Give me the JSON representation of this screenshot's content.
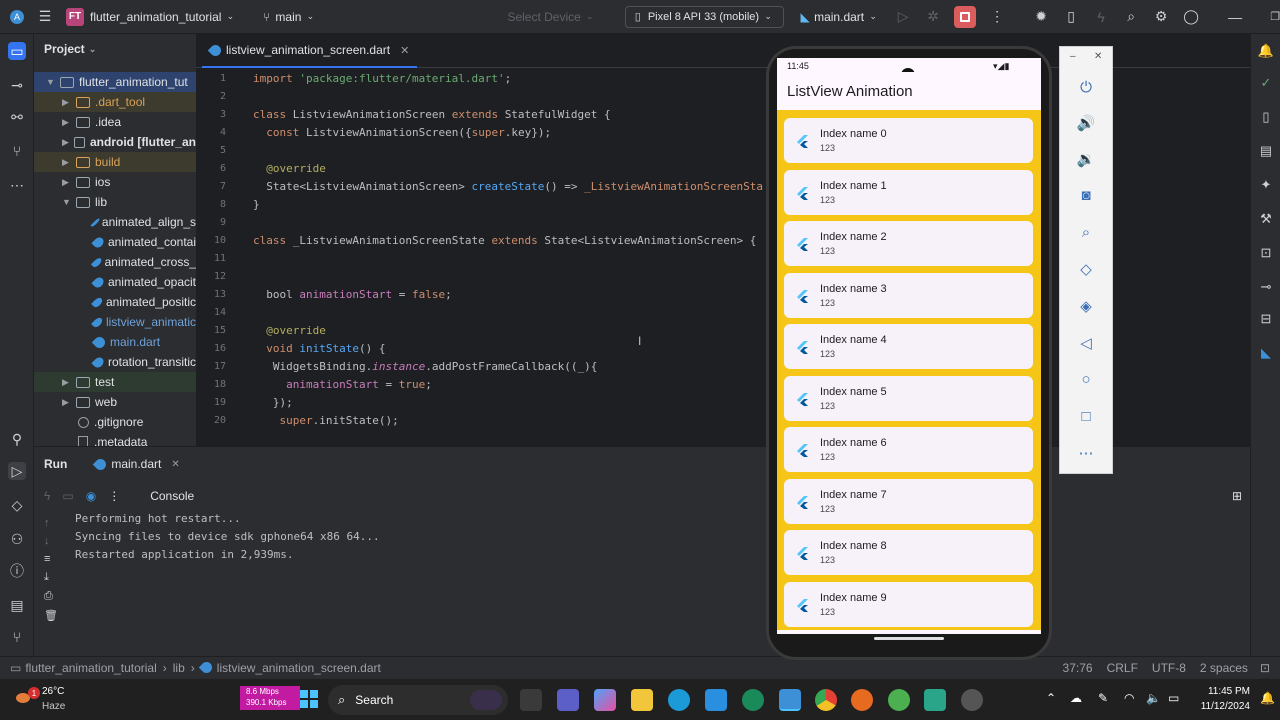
{
  "titlebar": {
    "project_badge": "FT",
    "project_name": "flutter_animation_tutorial",
    "branch": "main",
    "select_device": "Select Device",
    "device": "Pixel 8 API 33 (mobile)",
    "run_config": "main.dart"
  },
  "project_panel": {
    "title": "Project",
    "items": [
      {
        "label": "flutter_animation_tut",
        "type": "root"
      },
      {
        "label": ".dart_tool",
        "type": "folder-orange"
      },
      {
        "label": ".idea",
        "type": "folder"
      },
      {
        "label": "android [flutter_an",
        "type": "folder"
      },
      {
        "label": "build",
        "type": "folder-orange"
      },
      {
        "label": "ios",
        "type": "folder"
      },
      {
        "label": "lib",
        "type": "folder"
      },
      {
        "label": "animated_align_s",
        "type": "dart"
      },
      {
        "label": "animated_contai",
        "type": "dart"
      },
      {
        "label": "animated_cross_",
        "type": "dart"
      },
      {
        "label": "animated_opacit",
        "type": "dart"
      },
      {
        "label": "animated_positic",
        "type": "dart"
      },
      {
        "label": "listview_animatic",
        "type": "dart"
      },
      {
        "label": "main.dart",
        "type": "dart"
      },
      {
        "label": "rotation_transitic",
        "type": "dart"
      },
      {
        "label": "test",
        "type": "folder"
      },
      {
        "label": "web",
        "type": "folder"
      },
      {
        "label": ".gitignore",
        "type": "file"
      },
      {
        "label": ".metadata",
        "type": "file"
      }
    ]
  },
  "editor": {
    "tab": "listview_animation_screen.dart",
    "line_numbers": [
      "1",
      "2",
      "3",
      "4",
      "5",
      "6",
      "7",
      "8",
      "9",
      "10",
      "11",
      "12",
      "13",
      "14",
      "15",
      "16",
      "17",
      "18",
      "19",
      "20"
    ]
  },
  "run_panel": {
    "title": "Run",
    "tab": "main.dart",
    "console_label": "Console",
    "lines": [
      "Performing hot restart...",
      "Syncing files to device sdk gphone64 x86 64...",
      "Restarted application in 2,939ms."
    ]
  },
  "statusbar": {
    "path": [
      "flutter_animation_tutorial",
      "lib",
      "listview_animation_screen.dart"
    ],
    "position": "37:76",
    "line_ending": "CRLF",
    "encoding": "UTF-8",
    "indent": "2 spaces"
  },
  "emulator": {
    "time": "11:45",
    "app_title": "ListView Animation",
    "items": [
      {
        "title": "Index name 0",
        "subtitle": "123"
      },
      {
        "title": "Index name 1",
        "subtitle": "123"
      },
      {
        "title": "Index name 2",
        "subtitle": "123"
      },
      {
        "title": "Index name 3",
        "subtitle": "123"
      },
      {
        "title": "Index name 4",
        "subtitle": "123"
      },
      {
        "title": "Index name 5",
        "subtitle": "123"
      },
      {
        "title": "Index name 6",
        "subtitle": "123"
      },
      {
        "title": "Index name 7",
        "subtitle": "123"
      },
      {
        "title": "Index name 8",
        "subtitle": "123"
      },
      {
        "title": "Index name 9",
        "subtitle": "123"
      }
    ]
  },
  "taskbar": {
    "weather_temp": "26°C",
    "weather_desc": "Haze",
    "net_down": "8.6 Mbps",
    "net_up": "390.1 Kbps",
    "search": "Search",
    "weather_badge": "1",
    "time": "11:45 PM",
    "date": "11/12/2024"
  },
  "colors": {
    "accent": "#3574f0",
    "list_background": "#f5c518",
    "stop_button": "#db5c5c"
  }
}
